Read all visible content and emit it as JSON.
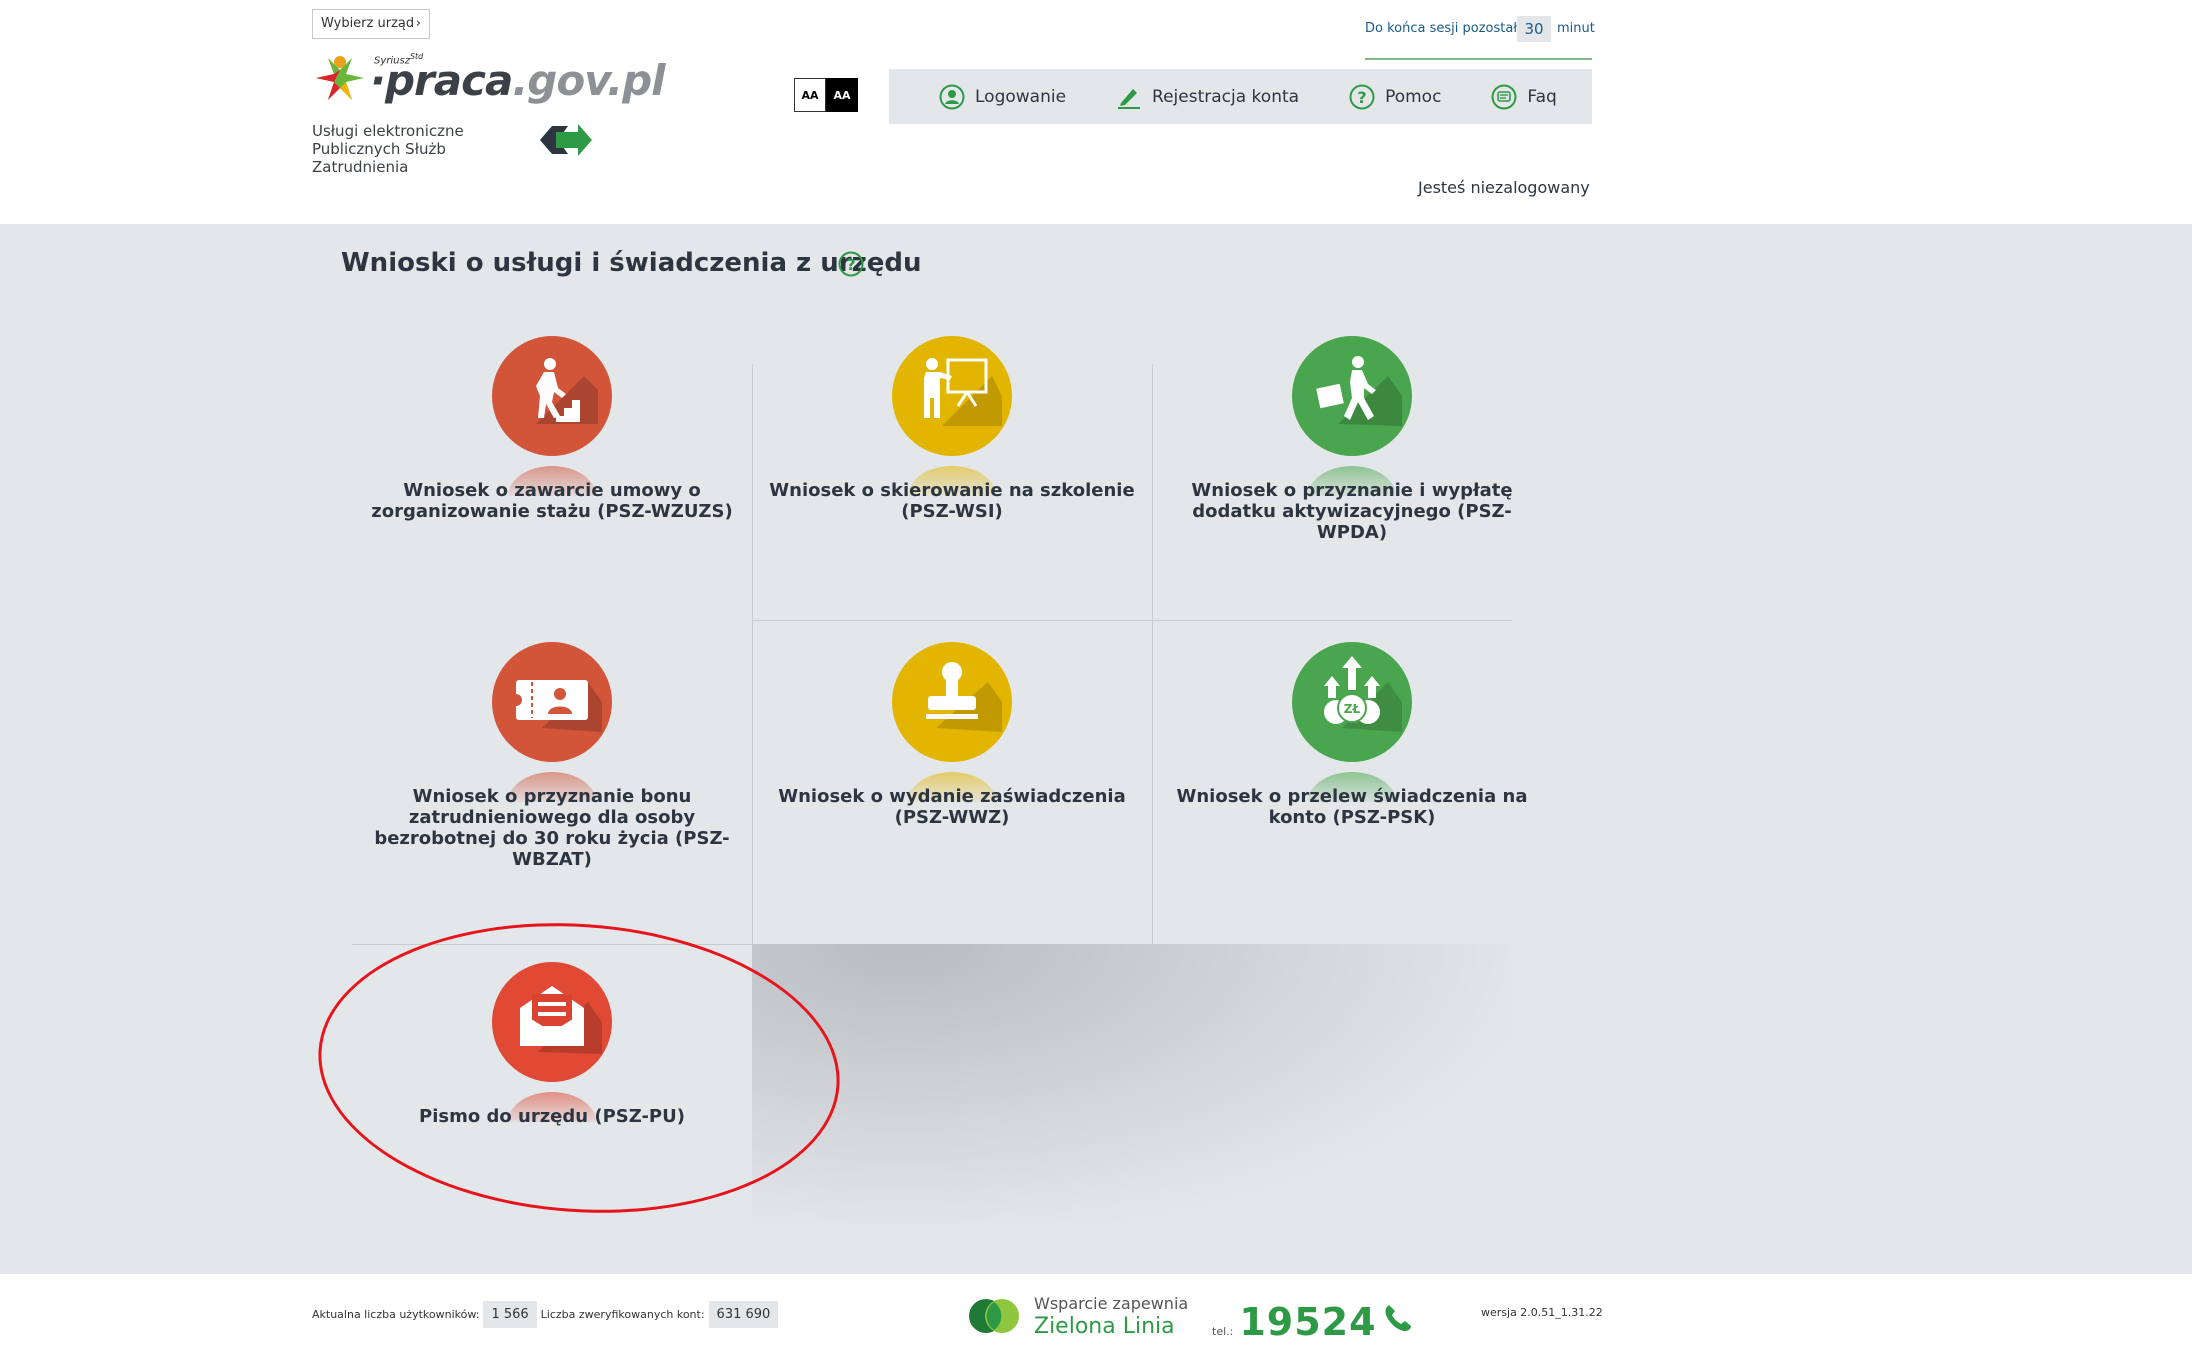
{
  "header": {
    "office_button": "Wybierz urząd",
    "logo_sup": "Syriusz",
    "logo_sup_std": "Std",
    "logo_praca": "praca",
    "logo_gov": ".gov.pl",
    "subtitle_line1": "Usługi elektroniczne",
    "subtitle_line2": "Publicznych Służb Zatrudnienia",
    "font_normal": "AA",
    "font_contrast": "AA",
    "session_label": "Do końca sesji pozostało",
    "session_minutes": "30",
    "session_unit": "minut",
    "nav": [
      {
        "label": "Logowanie",
        "icon": "user-icon"
      },
      {
        "label": "Rejestracja konta",
        "icon": "pencil-icon"
      },
      {
        "label": "Pomoc",
        "icon": "help-icon"
      },
      {
        "label": "Faq",
        "icon": "chat-icon"
      }
    ],
    "status": "Jesteś niezalogowany"
  },
  "main": {
    "title": "Wnioski o usługi i świadczenia z urzędu",
    "tiles": [
      {
        "label": "Wniosek o zawarcie umowy o zorganizowanie stażu (PSZ-WZUZS)",
        "color": "#d2553a",
        "icon": "stairs-icon"
      },
      {
        "label": "Wniosek o skierowanie na szkolenie (PSZ-WSI)",
        "color": "#e2b500",
        "icon": "training-icon"
      },
      {
        "label": "Wniosek o przyznanie i wypłatę dodatku aktywizacyjnego (PSZ-WPDA)",
        "color": "#4aa64e",
        "icon": "walking-man-icon"
      },
      {
        "label": "Wniosek o przyznanie bonu zatrudnieniowego dla osoby bezrobotnej do 30 roku życia (PSZ-WBZAT)",
        "color": "#d2553a",
        "icon": "voucher-icon"
      },
      {
        "label": "Wniosek o wydanie zaświadczenia (PSZ-WWZ)",
        "color": "#e2b500",
        "icon": "stamp-icon"
      },
      {
        "label": "Wniosek o przelew świadczenia na konto (PSZ-PSK)",
        "color": "#4aa64e",
        "icon": "money-transfer-icon"
      },
      {
        "label": "Pismo do urzędu (PSZ-PU)",
        "color": "#e04a35",
        "icon": "envelope-icon"
      }
    ]
  },
  "footer": {
    "users_label": "Aktualna liczba użytkowników:",
    "users_value": "1 566",
    "verified_label": "Liczba zweryfikowanych kont:",
    "verified_value": "631 690",
    "support_line1": "Wsparcie zapewnia",
    "support_line2": "Zielona Linia",
    "tel_label": "tel.:",
    "tel_number": "19524",
    "version": "wersja 2.0.51_1.31.22"
  }
}
